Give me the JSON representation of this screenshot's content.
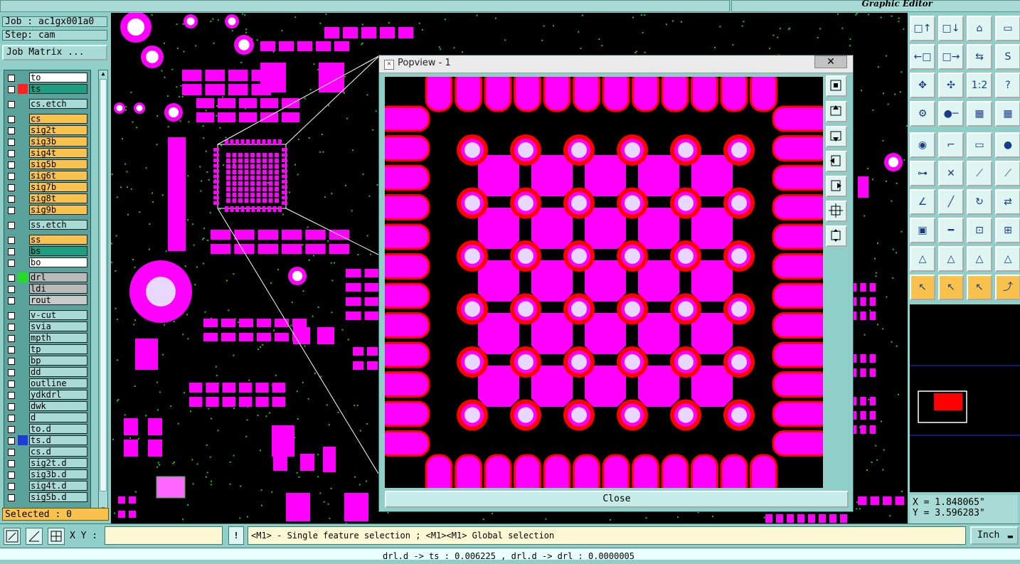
{
  "header": {
    "product": "Graphic Editor"
  },
  "job": {
    "job_label": "Job : ac1gx001a0",
    "step_label": "Step: cam",
    "matrix_button": "Job Matrix ..."
  },
  "layers": [
    {
      "name": "to",
      "bg": "#ffffff"
    },
    {
      "name": "ts",
      "bg": "#1d9e80",
      "swatch": "#ff2020",
      "active": true
    },
    {
      "name": "cs.etch",
      "bg": "#a9dbd6",
      "gap": true
    },
    {
      "name": "cs",
      "bg": "#f9c24c",
      "gap": true
    },
    {
      "name": "sig2t",
      "bg": "#f9c24c"
    },
    {
      "name": "sig3b",
      "bg": "#f9c24c"
    },
    {
      "name": "sig4t",
      "bg": "#f9c24c"
    },
    {
      "name": "sig5b",
      "bg": "#f9c24c"
    },
    {
      "name": "sig6t",
      "bg": "#f9c24c"
    },
    {
      "name": "sig7b",
      "bg": "#f9c24c"
    },
    {
      "name": "sig8t",
      "bg": "#f9c24c"
    },
    {
      "name": "sig9b",
      "bg": "#f9c24c"
    },
    {
      "name": "ss.etch",
      "bg": "#a9dbd6",
      "gap": true
    },
    {
      "name": "ss",
      "bg": "#f9c24c",
      "gap": true
    },
    {
      "name": "bs",
      "bg": "#1d9e80"
    },
    {
      "name": "bo",
      "bg": "#ffffff"
    },
    {
      "name": "drl",
      "bg": "#b9b9b9",
      "swatch": "#22dd22",
      "gap": true
    },
    {
      "name": "ldi",
      "bg": "#b9b9b9"
    },
    {
      "name": "rout",
      "bg": "#c9c9c9"
    },
    {
      "name": "v-cut",
      "bg": "#a9dbd6",
      "gap": true
    },
    {
      "name": "svia",
      "bg": "#a9dbd6"
    },
    {
      "name": "mpth",
      "bg": "#a9dbd6"
    },
    {
      "name": "tp",
      "bg": "#a9dbd6"
    },
    {
      "name": "bp",
      "bg": "#a9dbd6"
    },
    {
      "name": "dd",
      "bg": "#a9dbd6"
    },
    {
      "name": "outline",
      "bg": "#a9dbd6"
    },
    {
      "name": "ydkdrl",
      "bg": "#a9dbd6"
    },
    {
      "name": "dwk",
      "bg": "#a9dbd6"
    },
    {
      "name": "d",
      "bg": "#a9dbd6"
    },
    {
      "name": "to.d",
      "bg": "#a9dbd6"
    },
    {
      "name": "ts.d",
      "bg": "#a9dbd6",
      "swatch": "#1d3bd6"
    },
    {
      "name": "cs.d",
      "bg": "#a9dbd6"
    },
    {
      "name": "sig2t.d",
      "bg": "#a9dbd6"
    },
    {
      "name": "sig3b.d",
      "bg": "#a9dbd6"
    },
    {
      "name": "sig4t.d",
      "bg": "#a9dbd6"
    },
    {
      "name": "sig5b.d",
      "bg": "#a9dbd6"
    }
  ],
  "selected": "Selected : 0",
  "popview": {
    "title": "Popview - 1",
    "close_x": "✕",
    "close_button": "Close"
  },
  "coords": {
    "x": "X = 1.848065\"",
    "y": "Y = 3.596283\""
  },
  "bottom": {
    "xy_label": "X Y :",
    "xy_value": "",
    "warn": "!",
    "status": "<M1> - Single feature selection ; <M1><M1> Global selection",
    "unit": "Inch"
  },
  "footer": "drl.d -> ts : 0.006225 , drl.d -> drl : 0.0000005",
  "colors": {
    "pad": "#ff00ff",
    "ring": "#ff0000",
    "drill": "#e8d8ff",
    "trace_green": "#1ec81e"
  },
  "palette_icons": [
    "move-up-icon",
    "move-down-icon",
    "home-icon",
    "window-icon",
    "move-left-icon",
    "move-right-icon",
    "swap-icon",
    "reshape-icon",
    "fit-icon",
    "center-icon",
    "scale-1-2-icon",
    "help-icon",
    "settings-icon",
    "probe-icon",
    "layers-a-icon",
    "layers-b-icon",
    "pad-add-icon",
    "line-add-icon",
    "ruler-icon",
    "circle-icon",
    "node-icon",
    "cross-icon",
    "point-link-icon",
    "point-link-b-icon",
    "edge-icon",
    "slash-icon",
    "rotate-icon",
    "flip-icon",
    "pad-select-icon",
    "bar-icon",
    "frame-icon",
    "group-icon",
    "arc-a-icon",
    "arc-b-icon",
    "arc-c-icon",
    "arc-d-icon",
    "pointer-icon",
    "pointer-box-icon",
    "pointer-box-b-icon",
    "route-icon"
  ]
}
